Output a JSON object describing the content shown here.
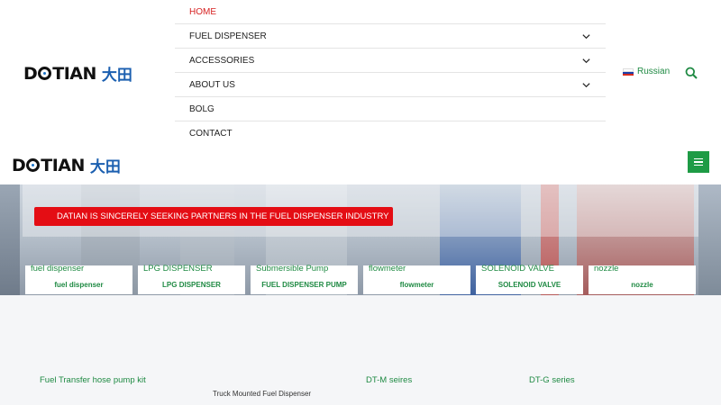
{
  "logo": {
    "latin": "DATIAN",
    "chinese": "大田"
  },
  "menu": [
    {
      "label": "HOME",
      "active": true,
      "has_submenu": false
    },
    {
      "label": "FUEL DISPENSER",
      "active": false,
      "has_submenu": true
    },
    {
      "label": "ACCESSORIES",
      "active": false,
      "has_submenu": true
    },
    {
      "label": "ABOUT US",
      "active": false,
      "has_submenu": true
    },
    {
      "label": "BOLG",
      "active": false,
      "has_submenu": false
    },
    {
      "label": "CONTACT",
      "active": false,
      "has_submenu": false
    }
  ],
  "language": {
    "label": "Russian",
    "flag_icon": "russia-flag-icon"
  },
  "search": {
    "icon": "search-icon"
  },
  "mini_header": {
    "menu_icon": "hamburger-icon"
  },
  "banner": {
    "promo_text": "DATIAN IS SINCERELY SEEKING PARTNERS IN THE FUEL DISPENSER INDUSTRY"
  },
  "product_cards": [
    {
      "title": "fuel dispenser",
      "label": "fuel dispenser"
    },
    {
      "title": "LPG DISPENSER",
      "label": "LPG DISPENSER"
    },
    {
      "title": "Submersible Pump",
      "label": "FUEL DISPENSER PUMP"
    },
    {
      "title": "flowmeter",
      "label": "flowmeter"
    },
    {
      "title": "SOLENOID VALVE",
      "label": "SOLENOID VALVE"
    },
    {
      "title": "nozzle",
      "label": "nozzle"
    }
  ],
  "sections": [
    {
      "label": "Fuel Transfer hose pump kit"
    },
    {
      "label": "DT-M seires"
    },
    {
      "label": "DT-G series"
    }
  ],
  "section_caption": "Truck Mounted Fuel Dispenser",
  "colors": {
    "brand_green": "#1f8a43",
    "accent_red": "#e40d14",
    "active_red": "#d62222",
    "logo_blue": "#1b5fb0"
  }
}
